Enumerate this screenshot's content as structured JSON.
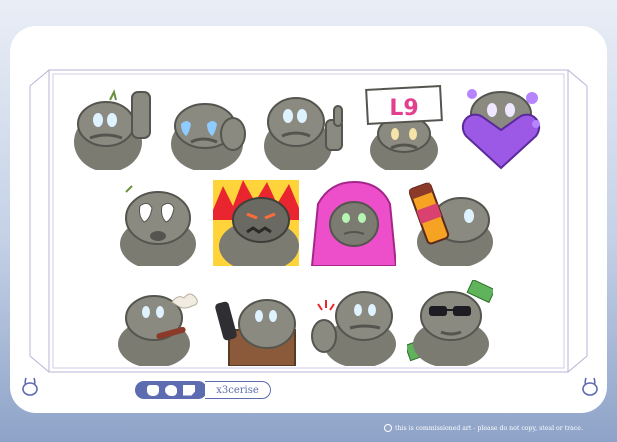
{
  "colors": {
    "accent": "#5d6bb0",
    "rock": "#7b7b72",
    "rock_shadow": "#55554f",
    "eye_glow": "#dff2ff"
  },
  "emotes": [
    {
      "id": "wave",
      "eyes": "glow"
    },
    {
      "id": "cry",
      "eyes": "tears"
    },
    {
      "id": "thumbs-up",
      "eyes": "glow"
    },
    {
      "id": "l9-sign",
      "sign_text": "L9"
    },
    {
      "id": "heart",
      "eyes": "purple"
    },
    {
      "id": "shocked",
      "eyes": "blank"
    },
    {
      "id": "rage",
      "eyes": "red"
    },
    {
      "id": "blanket",
      "eyes": "green"
    },
    {
      "id": "sip-drink",
      "eyes": "glow"
    },
    {
      "id": "smoke",
      "eyes": "glow"
    },
    {
      "id": "remote",
      "eyes": "glow"
    },
    {
      "id": "pinch",
      "eyes": "glow"
    },
    {
      "id": "money-sunglasses",
      "eyes": "sunglasses"
    }
  ],
  "social": {
    "handle": "x3cerise",
    "icons": [
      "kofi-icon",
      "twitter-icon",
      "twitch-icon"
    ]
  },
  "footer": {
    "notice": "this is commissioned art - please do not copy, steal or trace."
  }
}
